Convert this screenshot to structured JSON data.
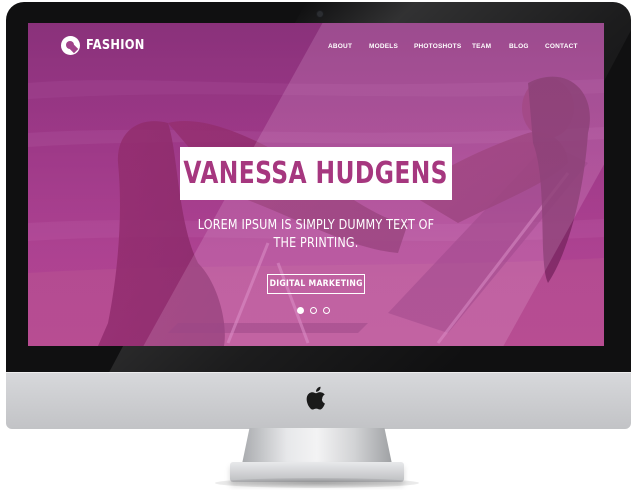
{
  "brand": {
    "name": "FASHION",
    "logo_icon": "fashion-logo-icon"
  },
  "nav": {
    "items": [
      {
        "label": "ABOUT"
      },
      {
        "label": "MODELS"
      },
      {
        "label": "PHOTOSHOTS"
      },
      {
        "label": "TEAM"
      },
      {
        "label": "BLOG"
      },
      {
        "label": "CONTACT"
      }
    ]
  },
  "hero": {
    "title": "VANESSA HUDGENS",
    "subtitle": "LOREM IPSUM IS SIMPLY DUMMY TEXT OF THE PRINTING.",
    "cta_label": "DIGITAL MARKETING",
    "slides": {
      "count": 3,
      "active_index": 0
    }
  },
  "colors": {
    "accent": "#a6377f",
    "overlay": "#b23a8e",
    "text_on_overlay": "#ffffff"
  },
  "device": {
    "icon": "apple-logo-icon"
  }
}
